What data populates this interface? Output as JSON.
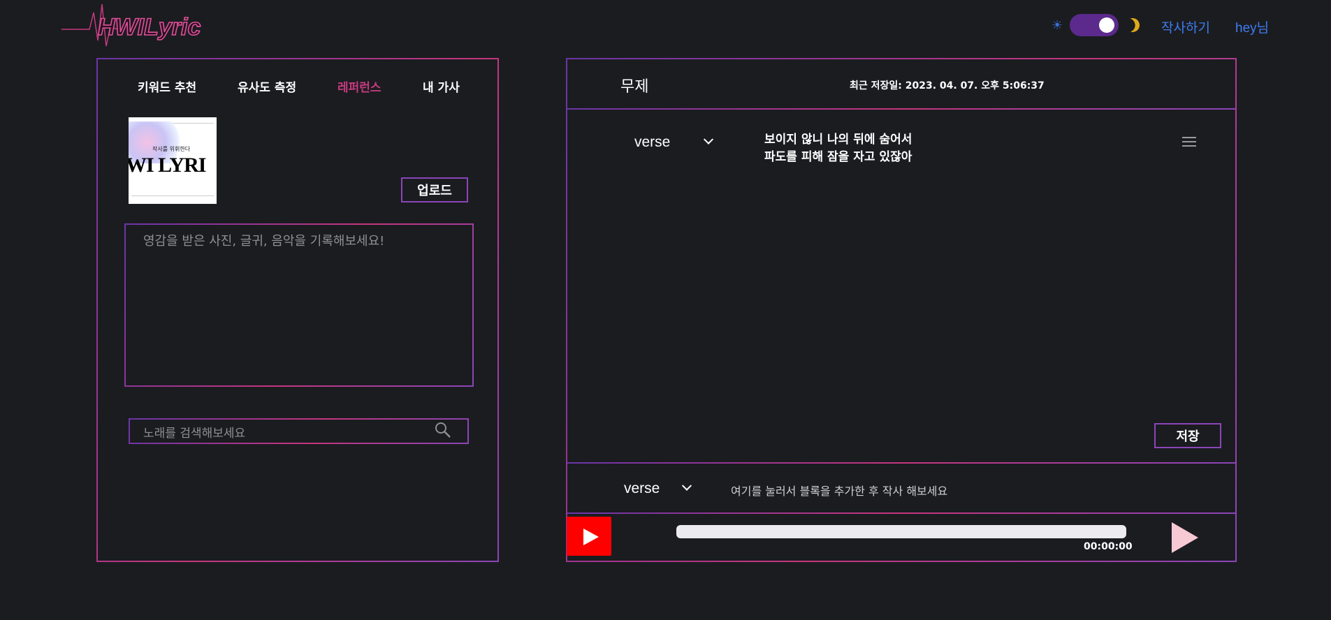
{
  "header": {
    "logo_text": "HWILyric",
    "nav": {
      "write": "작사하기",
      "user": "hey님"
    },
    "theme_toggle": {
      "state": "dark"
    }
  },
  "left_panel": {
    "tabs": [
      {
        "label": "키워드 추천",
        "active": false
      },
      {
        "label": "유사도 측정",
        "active": false
      },
      {
        "label": "레퍼런스",
        "active": true
      },
      {
        "label": "내 가사",
        "active": false
      }
    ],
    "thumbnail": {
      "small_text": "작사를 위휘한다",
      "big_text": "WI LYRI"
    },
    "upload_label": "업로드",
    "memo_placeholder": "영감을 받은 사진, 글귀, 음악을 기록해보세요!",
    "search_placeholder": "노래를 검색해보세요"
  },
  "right_panel": {
    "title": "무제",
    "last_saved": "최근 저장일: 2023. 04. 07. 오후 5:06:37",
    "block": {
      "type": "verse",
      "lines": [
        "보이지 않니 나의 뒤에 숨어서",
        "파도를 피해 잠을 자고 있잖아"
      ]
    },
    "save_label": "저장",
    "new_block": {
      "type": "verse",
      "hint": "여기를 눌러서 블록을 추가한 후 작사 해보세요"
    },
    "player": {
      "time": "00:00:00",
      "progress": 0
    }
  },
  "colors": {
    "accent_pink": "#c43a7e",
    "accent_purple": "#8a45b8",
    "link_blue": "#3d7cf0",
    "background": "#1b1c20"
  }
}
